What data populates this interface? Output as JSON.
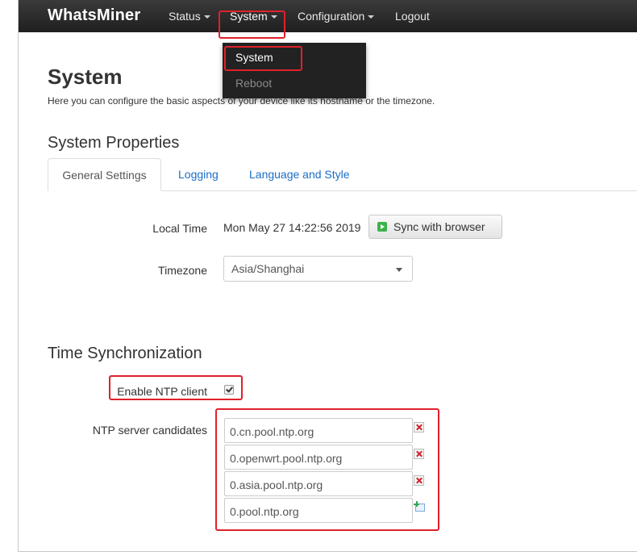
{
  "navbar": {
    "brand": "WhatsMiner",
    "items": [
      {
        "label": "Status"
      },
      {
        "label": "System"
      },
      {
        "label": "Configuration"
      },
      {
        "label": "Logout"
      }
    ]
  },
  "dropdown": {
    "items": [
      {
        "label": "System"
      },
      {
        "label": "Reboot"
      }
    ]
  },
  "page": {
    "title": "System",
    "description": "Here you can configure the basic aspects of your device like its hostname or the timezone."
  },
  "system_properties": {
    "title": "System Properties",
    "tabs": [
      {
        "label": "General Settings"
      },
      {
        "label": "Logging"
      },
      {
        "label": "Language and Style"
      }
    ],
    "local_time_label": "Local Time",
    "local_time_value": "Mon May 27 14:22:56 2019",
    "sync_button_label": "Sync with browser",
    "timezone_label": "Timezone",
    "timezone_value": "Asia/Shanghai"
  },
  "time_sync": {
    "title": "Time Synchronization",
    "enable_ntp_label": "Enable NTP client",
    "enable_ntp_checked": true,
    "ntp_servers_label": "NTP server candidates",
    "ntp_servers": [
      "0.cn.pool.ntp.org",
      "0.openwrt.pool.ntp.org",
      "0.asia.pool.ntp.org",
      "0.pool.ntp.org"
    ]
  },
  "colors": {
    "highlight": "#e0212b",
    "link": "#1a6dc7",
    "navbar": "#222222"
  }
}
